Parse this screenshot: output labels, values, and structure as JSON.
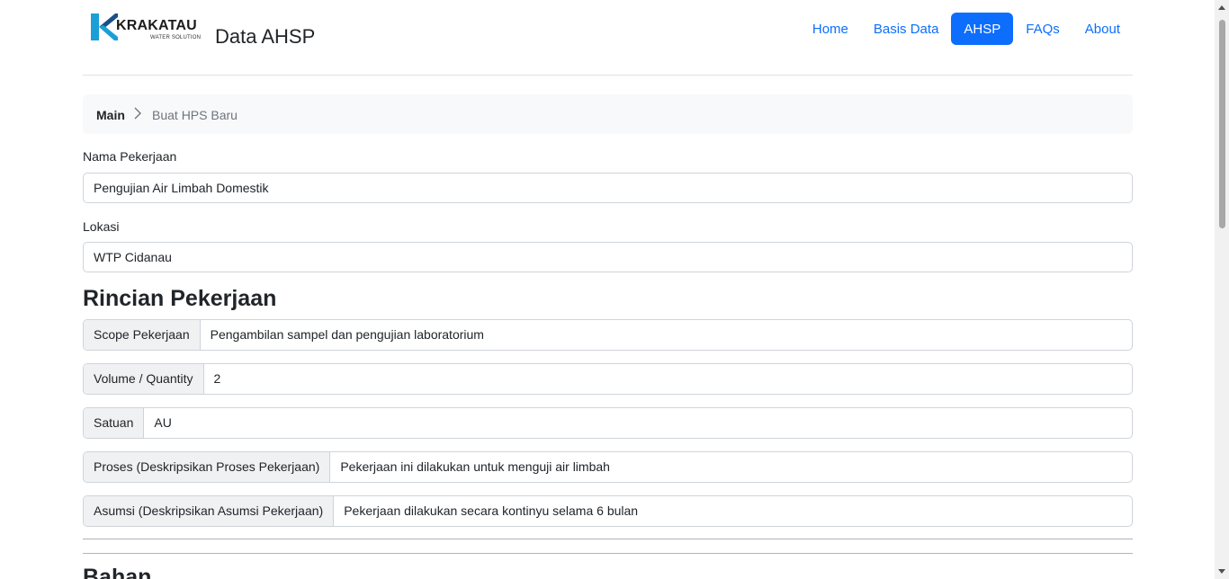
{
  "header": {
    "logo_text": "KRAKATAU",
    "logo_subtext": "WATER SOLUTION",
    "site_title": "Data AHSP",
    "nav": [
      {
        "label": "Home",
        "active": false
      },
      {
        "label": "Basis Data",
        "active": false
      },
      {
        "label": "AHSP",
        "active": true
      },
      {
        "label": "FAQs",
        "active": false
      },
      {
        "label": "About",
        "active": false
      }
    ]
  },
  "breadcrumb": {
    "main": "Main",
    "current": "Buat HPS Baru"
  },
  "form": {
    "nama_label": "Nama Pekerjaan",
    "nama_value": "Pengujian Air Limbah Domestik",
    "lokasi_label": "Lokasi",
    "lokasi_value": "WTP Cidanau"
  },
  "rincian": {
    "title": "Rincian Pekerjaan",
    "rows": [
      {
        "label": "Scope Pekerjaan",
        "value": "Pengambilan sampel dan pengujian laboratorium"
      },
      {
        "label": "Volume / Quantity",
        "value": "2"
      },
      {
        "label": "Satuan",
        "value": "AU"
      },
      {
        "label": "Proses (Deskripsikan Proses Pekerjaan)",
        "value": "Pekerjaan ini dilakukan untuk menguji air limbah"
      },
      {
        "label": "Asumsi (Deskripsikan Asumsi Pekerjaan)",
        "value": "Pekerjaan dilakukan secara kontinyu selama 6 bulan"
      }
    ]
  },
  "next_section": {
    "title": "Bahan"
  },
  "colors": {
    "primary": "#0d6efd",
    "logo_cyan": "#1b9fd6",
    "logo_navy": "#1a4f8b"
  }
}
